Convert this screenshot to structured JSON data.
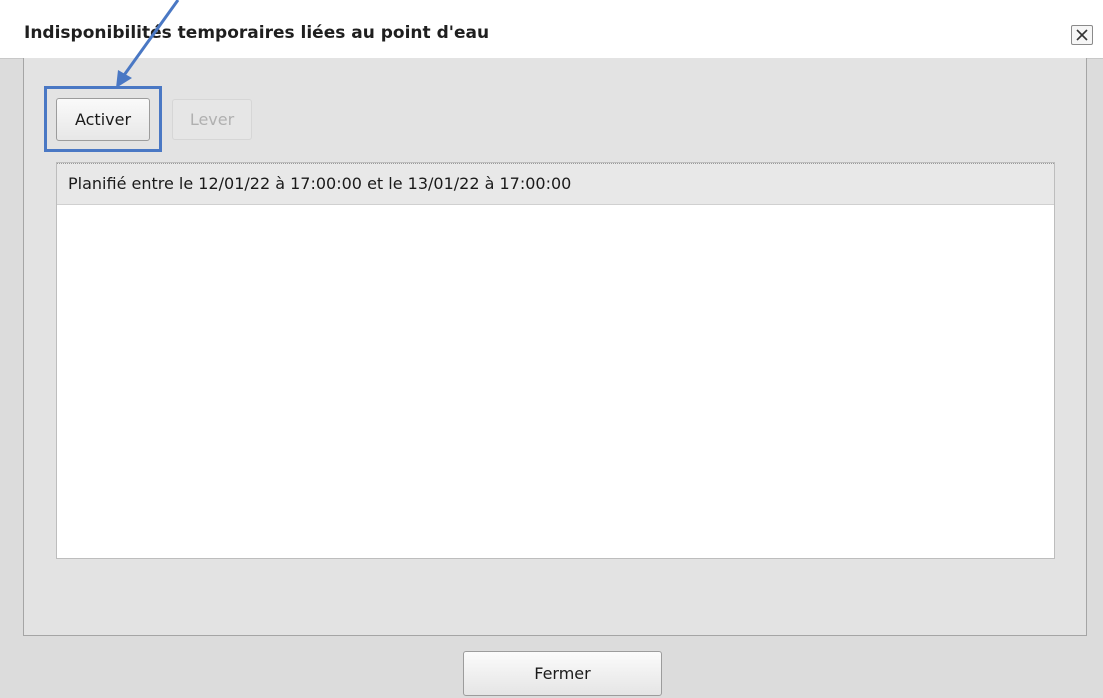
{
  "dialog": {
    "title": "Indisponibilités temporaires liées au point d'eau",
    "close_symbol": "✕",
    "close_icon": "close-icon"
  },
  "toolbar": {
    "activate_label": "Activer",
    "lift_label": "Lever",
    "lift_enabled": false
  },
  "list": {
    "items": [
      {
        "label": "Planifié entre le 12/01/22 à 17:00:00 et le 13/01/22 à 17:00:00"
      }
    ]
  },
  "footer": {
    "close_label": "Fermer"
  },
  "annotation": {
    "highlight_color": "#4a78c4",
    "arrow_icon": "arrow-pointer-icon"
  }
}
